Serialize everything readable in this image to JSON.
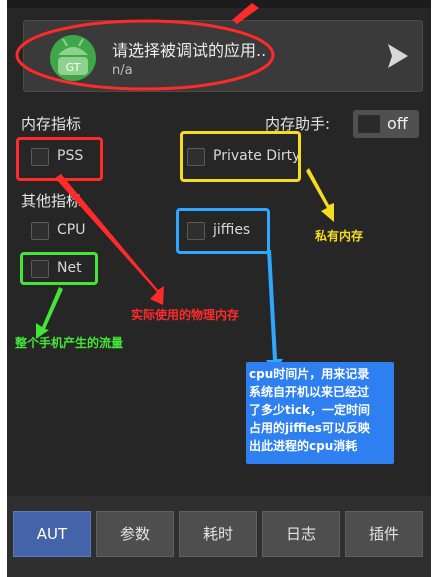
{
  "app_selector": {
    "title": "请选择被调试的应用..",
    "subtitle": "n/a",
    "icon_text": "GT",
    "icon_name": "android-icon",
    "arrow_icon": "chevron-right-icon"
  },
  "memory": {
    "section_label": "内存指标",
    "assistant_label": "内存助手:",
    "assistant_toggle": "off",
    "items": [
      {
        "label": "PSS",
        "checked": false
      },
      {
        "label": "Private Dirty",
        "checked": false
      }
    ]
  },
  "other": {
    "section_label": "其他指标",
    "items": [
      {
        "label": "CPU",
        "checked": false
      },
      {
        "label": "jiffies",
        "checked": false
      },
      {
        "label": "Net",
        "checked": false
      }
    ]
  },
  "annotations": {
    "private": "私有内存",
    "physical": "实际使用的物理内存",
    "traffic": "整个手机产生的流量",
    "cpu_lines": [
      "cpu时间片，用来记录",
      "系统自开机以来已经过",
      "了多少tick，一定时间",
      "占用的jiffies可以反映",
      "出此进程的cpu消耗"
    ]
  },
  "tabs": [
    {
      "label": "AUT",
      "active": true
    },
    {
      "label": "参数",
      "active": false
    },
    {
      "label": "耗时",
      "active": false
    },
    {
      "label": "日志",
      "active": false
    },
    {
      "label": "插件",
      "active": false
    }
  ],
  "colors": {
    "background": "#262626",
    "red": "#ff2a2a",
    "yellow": "#f5dc1f",
    "blue": "#2ea8ff",
    "green": "#43e635",
    "tab_active": "#4563a8"
  }
}
